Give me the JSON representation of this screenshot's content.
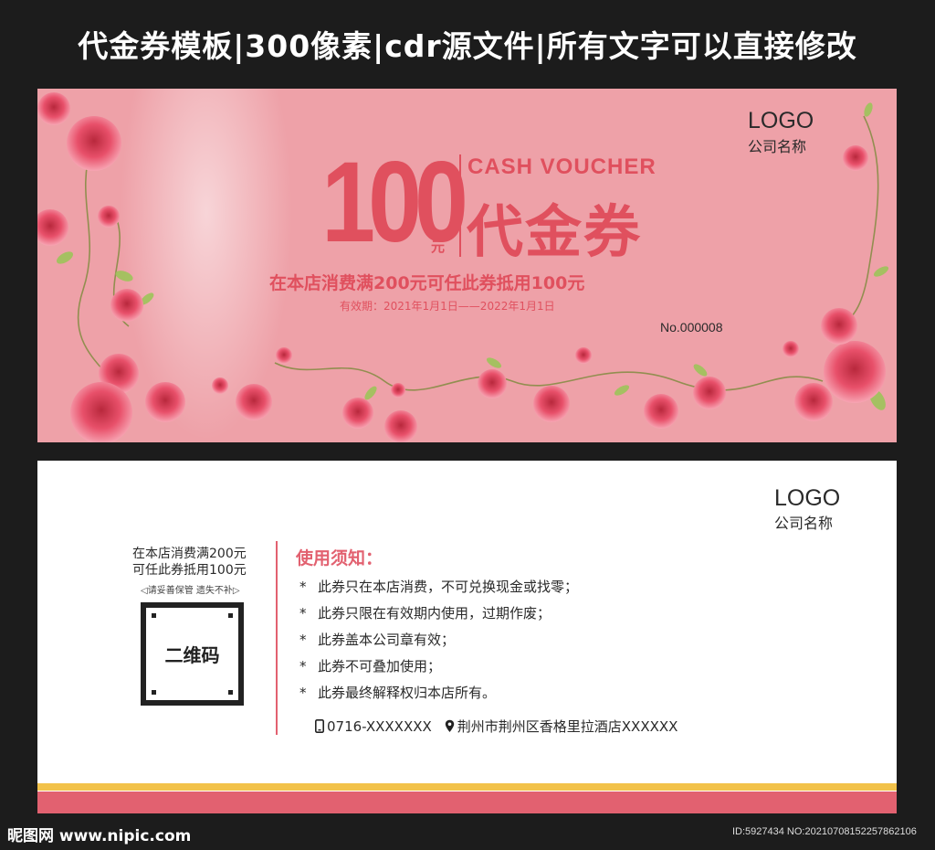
{
  "banner": {
    "title": "代金券模板|300像素|cdr源文件|所有文字可以直接修改"
  },
  "front": {
    "amount": "100",
    "unit": "元",
    "subtitle_en": "CASH VOUCHER",
    "title_cn": "代金券",
    "offer": "在本店消费满200元可任此券抵用100元",
    "validity": "有效期：2021年1月1日——2022年1月1日",
    "serial": "No.000008",
    "logo": "LOGO",
    "company": "公司名称"
  },
  "back": {
    "logo": "LOGO",
    "company": "公司名称",
    "offer_line1": "在本店消费满200元",
    "offer_line2": "可任此券抵用100元",
    "hint": "◁请妥善保管  遗失不补▷",
    "qr_label": "二维码",
    "rules_title": "使用须知：",
    "rules": [
      "此券只在本店消费，不可兑换现金或找零；",
      "此券只限在有效期内使用，过期作废；",
      "此券盖本公司章有效；",
      "此券不可叠加使用；",
      "此券最终解释权归本店所有。"
    ],
    "phone": "0716-XXXXXXX",
    "address": "荆州市荆州区香格里拉酒店XXXXXX",
    "icons": {
      "phone": "phone-icon",
      "location": "location-pin-icon"
    }
  },
  "watermark": {
    "site": "昵图网 www.nipic.com",
    "id": "ID:5927434 NO:20210708152257862106"
  },
  "colors": {
    "front_bg": "#eea1a8",
    "accent": "#e0505e",
    "back_accent": "#e26170",
    "stripe_yellow": "#f2c24a",
    "frame": "#1c1c1c"
  }
}
